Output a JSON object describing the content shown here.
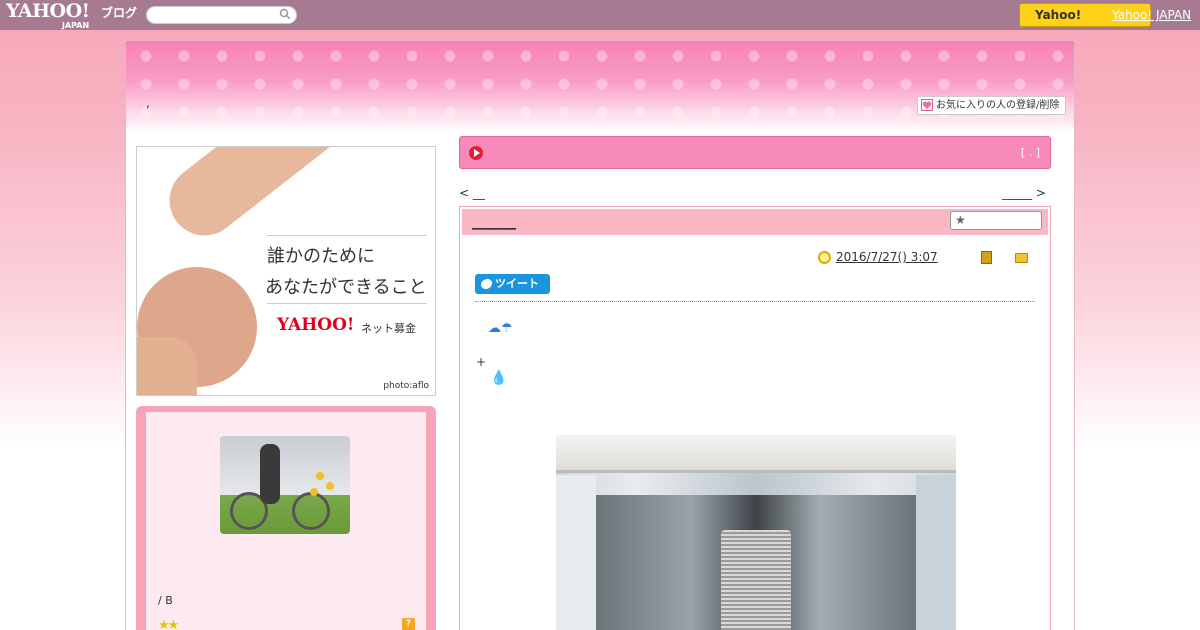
{
  "topbar": {
    "logo": "YAHOO!",
    "logo_sub": "JAPAN",
    "blog_label": "ブログ",
    "search_placeholder": "",
    "button_label": "Yahoo!",
    "link_label": "Yahoo! JAPAN"
  },
  "header": {
    "title": ",",
    "fav_label": "お気に入りの人の登録/削除"
  },
  "banner": {
    "line1": "誰かのために",
    "line2": "あなたができること",
    "logo": "YAHOO!",
    "logo_sub": "ネット募金",
    "credit": "photo:aflo"
  },
  "profile": {
    "name": "/ B",
    "stars": "★★",
    "question": "?"
  },
  "bar": {
    "right_text": "[ . ]"
  },
  "nav": {
    "prev": "< __",
    "next": "_____ >"
  },
  "post": {
    "title": "________",
    "star_label": "★",
    "date": "2016/7/27()  3:07    ",
    "tweet_label": "ツイート",
    "weather": "☁☂",
    "plus": "+",
    "drop": "💧"
  },
  "colors": {
    "topbar": "#a67b92",
    "accent_pink": "#f78ab9",
    "tweet_blue": "#1b95e0",
    "yahoo_yellow": "#ffd21a"
  }
}
